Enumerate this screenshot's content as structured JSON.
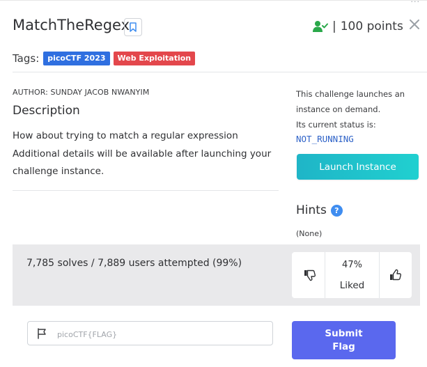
{
  "challenge": {
    "title": "MatchTheRegex",
    "points": "100 points",
    "points_separator": "|"
  },
  "tags": {
    "label": "Tags:",
    "items": [
      {
        "label": "picoCTF 2023",
        "color": "#2f6fe0"
      },
      {
        "label": "Web Exploitation",
        "color": "#e3474c"
      }
    ]
  },
  "description": {
    "author": "AUTHOR: SUNDAY JACOB NWANYIM",
    "heading": "Description",
    "lines": [
      "How about trying to match a regular expression",
      "Additional details will be available after launching your",
      "challenge instance."
    ]
  },
  "instance": {
    "info_lines": [
      "This challenge launches an",
      "instance on demand.",
      "Its current status is:"
    ],
    "status": "NOT_RUNNING",
    "launch_label": "Launch Instance"
  },
  "hints": {
    "heading": "Hints",
    "help_glyph": "?",
    "content": "(None)"
  },
  "stats": {
    "solves_text": "7,785 solves / 7,889 users attempted (99%)",
    "liked_percent": "47%",
    "liked_label": "Liked"
  },
  "flag": {
    "placeholder": "picoCTF{FLAG}",
    "submit_label": "Submit Flag"
  },
  "colors": {
    "accent_teal": "#1fb5c7",
    "submit_indigo": "#5a68ee",
    "solved_green": "#2aa84a",
    "status_blue": "#2f63c8"
  }
}
